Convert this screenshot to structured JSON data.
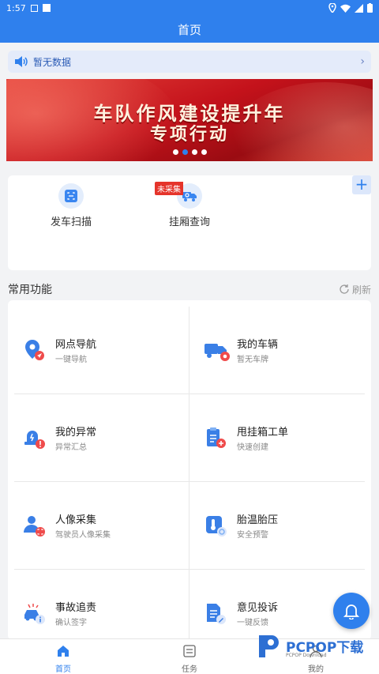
{
  "status_bar": {
    "time": "1:57"
  },
  "header": {
    "title": "首页"
  },
  "notice": {
    "text": "暂无数据",
    "chevron": "›"
  },
  "banner": {
    "line1": "车队作风建设提升年",
    "line2": "专项行动",
    "slide_count": 4,
    "active_slide": 1
  },
  "quick_actions": [
    {
      "label": "发车扫描",
      "icon": "scan-icon"
    },
    {
      "label": "挂厢查询",
      "icon": "truck-search-icon"
    }
  ],
  "add_button": {
    "label": "+"
  },
  "section": {
    "title": "常用功能",
    "refresh_label": "刷新"
  },
  "features": [
    {
      "name": "网点导航",
      "sub": "一键导航",
      "icon": "location-nav-icon"
    },
    {
      "name": "我的车辆",
      "sub": "暂无车牌",
      "icon": "truck-settings-icon"
    },
    {
      "name": "我的异常",
      "sub": "异常汇总",
      "icon": "alarm-warning-icon"
    },
    {
      "name": "甩挂箱工单",
      "sub": "快速创建",
      "icon": "clipboard-add-icon"
    },
    {
      "name": "人像采集",
      "sub": "驾驶员人像采集",
      "icon": "face-capture-icon"
    },
    {
      "name": "胎温胎压",
      "sub": "安全预警",
      "icon": "thermometer-icon"
    },
    {
      "name": "事故追责",
      "sub": "确认签字",
      "icon": "car-accident-icon"
    },
    {
      "name": "意见投诉",
      "sub": "一键反馈",
      "icon": "feedback-doc-icon"
    }
  ],
  "badge": {
    "text": "未采集"
  },
  "tabs": [
    {
      "label": "首页",
      "icon": "home-icon",
      "active": true
    },
    {
      "label": "任务",
      "icon": "task-list-icon",
      "active": false
    },
    {
      "label": "我的",
      "icon": "user-icon",
      "active": false
    }
  ],
  "watermark": {
    "text": "PCPOP下载",
    "small": "PCPOP Download"
  },
  "colors": {
    "primary": "#2f80ed",
    "danger": "#e5342b",
    "icon_bg": "#e3edfc"
  }
}
